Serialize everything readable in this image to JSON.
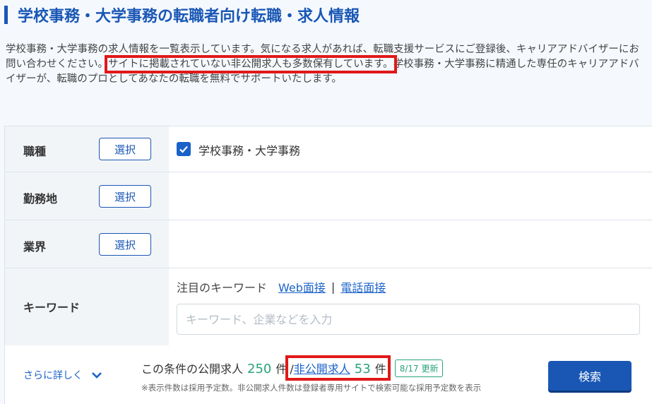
{
  "page": {
    "title": "学校事務・大学事務の転職者向け転職・求人情報"
  },
  "intro": {
    "part1": "学校事務・大学事務の求人情報を一覧表示しています。気になる求人があれば、転職支援サービスにご登録後、キャリアアドバイザーにお問い合わせください。",
    "highlight": "サイトに掲載されていない非公開求人も多数保有しています。",
    "part2": "学校事務・大学事務に精通した専任のキャリアアドバイザーが、転職のプロとしてあなたの転職を無料でサポートいたします。"
  },
  "filters": {
    "job_type": {
      "label": "職種",
      "button": "選択",
      "selected": "学校事務・大学事務"
    },
    "location": {
      "label": "勤務地",
      "button": "選択"
    },
    "industry": {
      "label": "業界",
      "button": "選択"
    },
    "keyword": {
      "label": "キーワード",
      "hint_prefix": "注目のキーワード",
      "link_web": "Web面接",
      "separator": "|",
      "link_phone": "電話面接",
      "placeholder": "キーワード、企業などを入力",
      "value": ""
    }
  },
  "footer": {
    "more_label": "さらに詳しく",
    "count_prefix": "この条件の公開求人",
    "public_count": "250",
    "unit": "件",
    "slash": "/",
    "nonpublic_label": "非公開求人",
    "nonpublic_count": "53",
    "updated_badge": "8/17 更新",
    "note": "※表示件数は採用予定数。非公開求人件数は登録者専用サイトで検索可能な採用予定数を表示",
    "search_button": "検索"
  },
  "colors": {
    "brand_blue": "#1a57b5",
    "link_blue": "#1a62c9",
    "count_green": "#2aa37a",
    "highlight_red": "#e01919"
  },
  "icons": {
    "checkbox": "check-icon",
    "more": "chevron-down-icon"
  }
}
